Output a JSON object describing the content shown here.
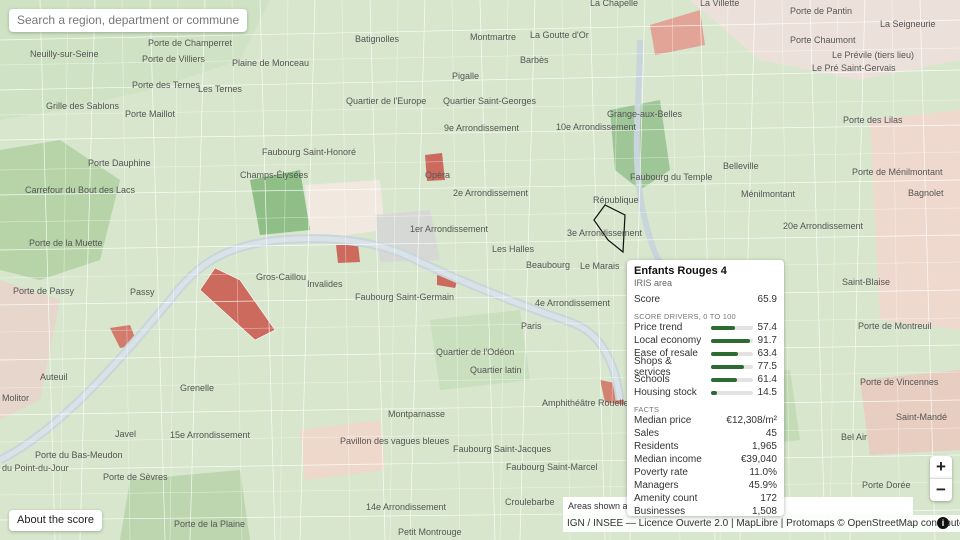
{
  "search": {
    "placeholder": "Search a region, department or commune"
  },
  "about_button": "About the score",
  "zoom": {
    "in": "+",
    "out": "−"
  },
  "legend_note": "Areas shown ar… varies with density: dense cities",
  "attribution": "IGN / INSEE — Licence Ouverte 2.0 | MapLibre | Protomaps © OpenStreetMap contributors",
  "info_icon": "i",
  "colors": {
    "high": "#5e9a5a",
    "mid": "#b9d4ad",
    "neutral": "#eae6dc",
    "low": "#e8b8ab",
    "very_low": "#cc6a5e",
    "selection": "#111111"
  },
  "map_labels": [
    "Porte de Champerret",
    "Porte de Villiers",
    "Neuilly-sur-Seine",
    "Plaine de Monceau",
    "Batignolles",
    "Montmartre",
    "La Goutte d'Or",
    "La Chapelle",
    "La Villette",
    "Porte de Pantin",
    "La Seigneurie",
    "Porte Chaumont",
    "Le Pré Saint-Gervais",
    "Le Prévile (tiers lieu)",
    "Porte des Ternes",
    "Les Ternes",
    "Pigalle",
    "Barbès",
    "Grille des Sablons",
    "Porte Maillot",
    "Quartier de l'Europe",
    "Quartier Saint-Georges",
    "9e Arrondissement",
    "10e Arrondissement",
    "Grange-aux-Belles",
    "Porte des Lilas",
    "Faubourg Saint-Honoré",
    "Porte Dauphine",
    "Champs-Élysées",
    "Opéra",
    "Faubourg du Temple",
    "Belleville",
    "Porte de Ménilmontant",
    "Carrefour du Bout des Lacs",
    "2e Arrondissement",
    "République",
    "Ménilmontant",
    "Bagnolet",
    "1er Arrondissement",
    "3e Arrondissement",
    "20e Arrondissement",
    "Porte de la Muette",
    "Les Halles",
    "Le Marais",
    "Beaubourg",
    "Gros-Caillou",
    "Invalides",
    "Porte de Passy",
    "Passy",
    "Faubourg Saint-Germain",
    "4e Arrondissement",
    "Paris",
    "Saint-Blaise",
    "Porte de Montreuil",
    "Auteuil",
    "Quartier de l'Odéon",
    "Quartier latin",
    "Grenelle",
    "Amphithéâtre Rouelle",
    "Porte de Vincennes",
    "Molitor",
    "Montparnasse",
    "Saint-Mandé",
    "Javel",
    "15e Arrondissement",
    "Pavillon des vagues bleues",
    "Faubourg Saint-Jacques",
    "Bel Air",
    "Porte du Bas-Meudon",
    "Porte de Sèvres",
    "Faubourg Saint-Marcel",
    "Porte Dorée",
    "Croulebarbe",
    "14e Arrondissement",
    "Porte de la Plaine",
    "Petit Montrouge",
    "du Point-du-Jour"
  ],
  "panel": {
    "title": "Enfants Rouges 4",
    "subtitle": "IRIS area",
    "score_label": "Score",
    "score": "65.9",
    "drivers_heading": "SCORE DRIVERS, 0 TO 100",
    "drivers": [
      {
        "label": "Price trend",
        "value": 57.4,
        "display": "57.4"
      },
      {
        "label": "Local economy",
        "value": 91.7,
        "display": "91.7"
      },
      {
        "label": "Ease of resale",
        "value": 63.4,
        "display": "63.4"
      },
      {
        "label": "Shops & services",
        "value": 77.5,
        "display": "77.5"
      },
      {
        "label": "Schools",
        "value": 61.4,
        "display": "61.4"
      },
      {
        "label": "Housing stock",
        "value": 14.5,
        "display": "14.5"
      }
    ],
    "facts_heading": "FACTS",
    "facts": [
      {
        "label": "Median price",
        "value": "€12,308/m²"
      },
      {
        "label": "Sales",
        "value": "45"
      },
      {
        "label": "Residents",
        "value": "1,965"
      },
      {
        "label": "Median income",
        "value": "€39,040"
      },
      {
        "label": "Poverty rate",
        "value": "11.0%"
      },
      {
        "label": "Managers",
        "value": "45.9%"
      },
      {
        "label": "Amenity count",
        "value": "172"
      },
      {
        "label": "Businesses",
        "value": "1,508"
      }
    ]
  }
}
